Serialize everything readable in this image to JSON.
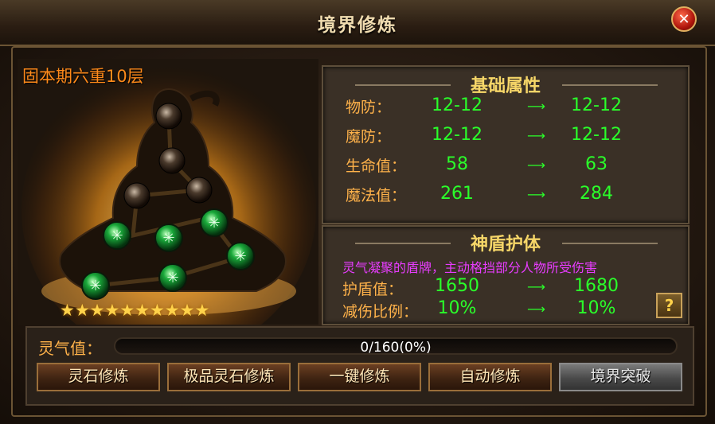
{
  "window": {
    "title": "境界修炼",
    "close_icon": "close-icon"
  },
  "figure": {
    "realm_label": "固本期六重10层",
    "stars": [
      "★",
      "★",
      "★",
      "★",
      "★",
      "★",
      "★",
      "★",
      "★",
      "★"
    ],
    "nodes_lit": 6,
    "nodes_total": 10
  },
  "basic": {
    "title": "基础属性",
    "rows": [
      {
        "label": "物防：",
        "from": "12-12",
        "to": "12-12"
      },
      {
        "label": "魔防：",
        "from": "12-12",
        "to": "12-12"
      },
      {
        "label": "生命值：",
        "from": "58",
        "to": "63"
      },
      {
        "label": "魔法值：",
        "from": "261",
        "to": "284"
      }
    ]
  },
  "shield": {
    "title": "神盾护体",
    "desc": "灵气凝聚的盾牌，主动格挡部分人物所受伤害",
    "rows": [
      {
        "label": "护盾值：",
        "from": "1650",
        "to": "1680"
      },
      {
        "label": "减伤比例：",
        "from": "10%",
        "to": "10%"
      }
    ],
    "help_label": "?"
  },
  "arrow": "⟶",
  "progress": {
    "label": "灵气值：",
    "text": "0/160(0%)",
    "fraction": 0
  },
  "buttons": {
    "stone": "灵石修炼",
    "premium": "极品灵石修炼",
    "oneclick": "一键修炼",
    "auto": "自动修炼",
    "breakthrough": "境界突破"
  },
  "colors": {
    "attr_value": "#2aff2a",
    "label": "#ffb24a",
    "title": "#f6d668",
    "realm": "#ff8a1a",
    "desc": "#e83cff"
  }
}
